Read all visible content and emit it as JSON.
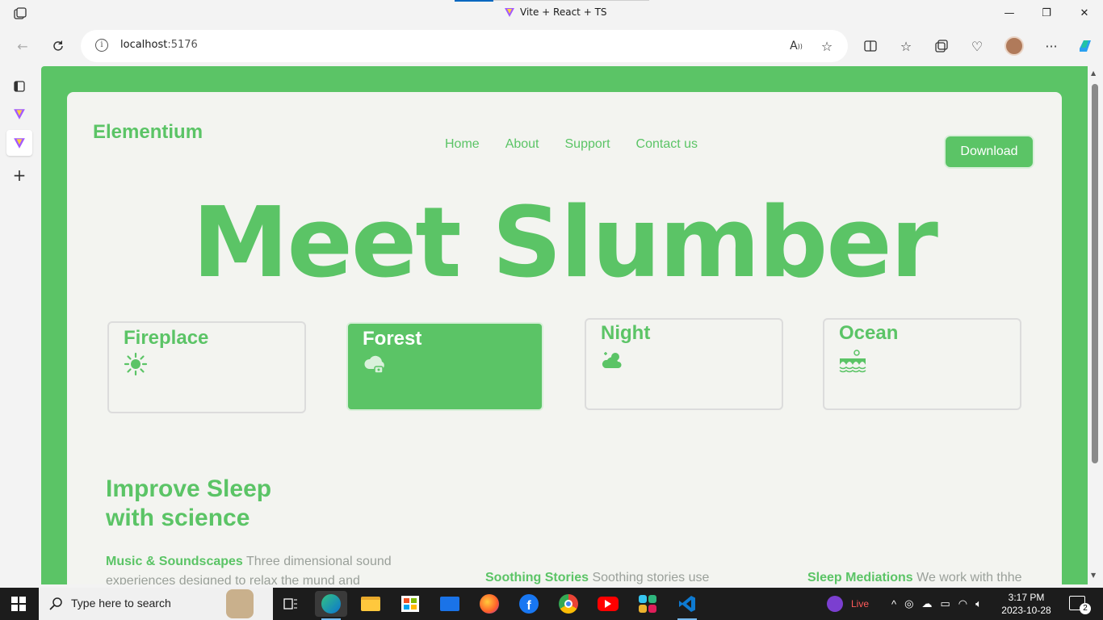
{
  "browser": {
    "tab_title": "Vite + React + TS",
    "url_host": "localhost",
    "url_port": ":5176",
    "minimize": "—",
    "restore": "❐",
    "close": "✕"
  },
  "page": {
    "brand": "Elementium",
    "nav": [
      "Home",
      "About",
      "Support",
      "Contact us"
    ],
    "download_label": "Download",
    "hero_title": "Meet Slumber",
    "sound_cards": [
      {
        "label": "Fireplace",
        "icon": "sun-icon",
        "active": false
      },
      {
        "label": "Forest",
        "icon": "cloud-lock-icon",
        "active": true
      },
      {
        "label": "Night",
        "icon": "cloud-sun-icon",
        "active": false
      },
      {
        "label": "Ocean",
        "icon": "waves-icon",
        "active": false
      }
    ],
    "science_title_line1": "Improve Sleep",
    "science_title_line2": "with science",
    "features": [
      {
        "title": "Music & Soundscapes",
        "text_line1": " Three dimensional sound",
        "text_line2": "experiences designed to relax the mund and"
      },
      {
        "title": "Soothing Stories",
        "text_line1": " Soothing stories use"
      },
      {
        "title": "Sleep Mediations",
        "text_line1": " We work with thhe"
      }
    ]
  },
  "taskbar": {
    "search_placeholder": "Type here to search",
    "live_label": "Live",
    "time": "3:17 PM",
    "date": "2023-10-28",
    "notification_count": "2"
  },
  "colors": {
    "accent_green": "#5bc466",
    "card_bg": "#f3f4f0",
    "muted_text": "#9aa09a"
  }
}
